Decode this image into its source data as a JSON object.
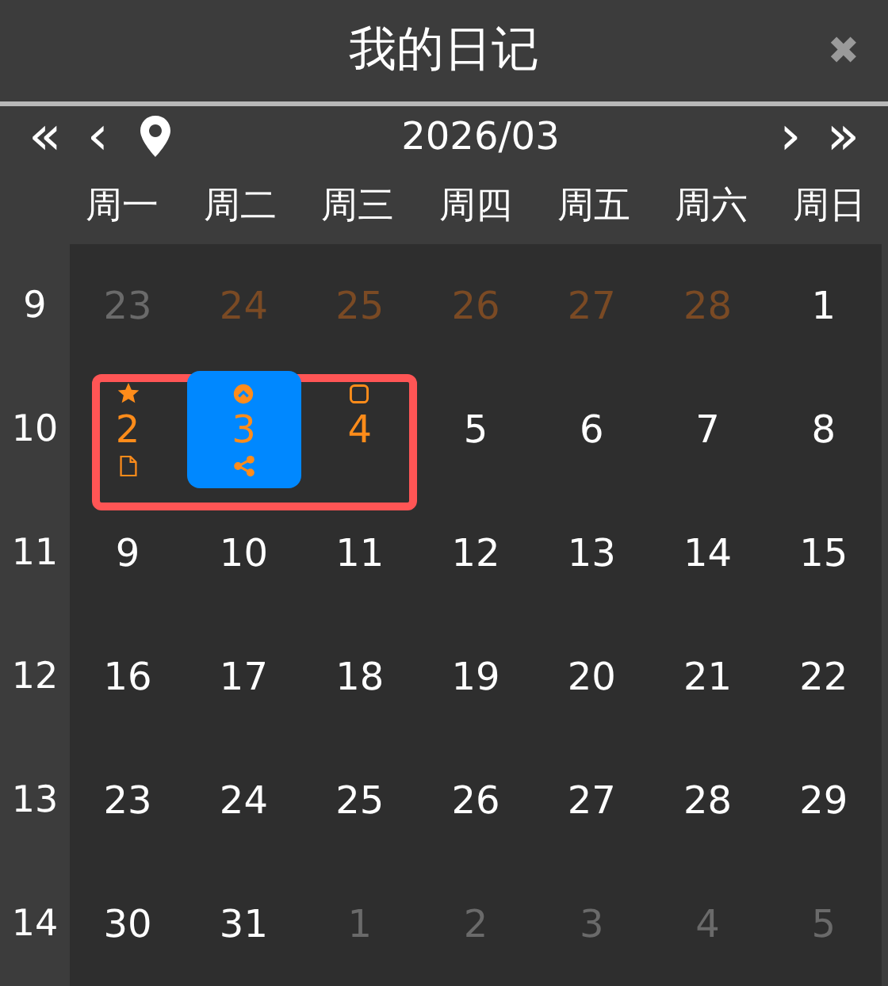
{
  "window": {
    "title": "我的日记",
    "close": "✖"
  },
  "nav": {
    "first": "«",
    "prev": "‹",
    "month": "2026/03",
    "next": "›",
    "last": "»"
  },
  "weekdays": [
    "周一",
    "周二",
    "周三",
    "周四",
    "周五",
    "周六",
    "周日"
  ],
  "weeks": [
    {
      "number": "9",
      "highlighted": false,
      "days": [
        {
          "day": "23",
          "kind": "other",
          "selected": false
        },
        {
          "day": "24",
          "kind": "other-marked",
          "selected": false
        },
        {
          "day": "25",
          "kind": "other-marked",
          "selected": false
        },
        {
          "day": "26",
          "kind": "other-marked",
          "selected": false
        },
        {
          "day": "27",
          "kind": "other-marked",
          "selected": false
        },
        {
          "day": "28",
          "kind": "other-marked",
          "selected": false
        },
        {
          "day": "1",
          "kind": "current",
          "selected": false
        }
      ]
    },
    {
      "number": "10",
      "highlighted": true,
      "days": [
        {
          "day": "2",
          "kind": "marked",
          "selected": false,
          "top_icons": [
            {
              "kind": "star"
            }
          ],
          "bottom_icons": [
            {
              "kind": "file"
            }
          ]
        },
        {
          "day": "3",
          "kind": "marked",
          "selected": true,
          "top_icons": [
            {
              "kind": "chevron"
            }
          ],
          "bottom_icons": [
            {
              "kind": "share"
            }
          ]
        },
        {
          "day": "4",
          "kind": "marked",
          "selected": false,
          "top_icons": [
            {
              "kind": "square"
            }
          ]
        },
        {
          "day": "5",
          "kind": "current",
          "selected": false
        },
        {
          "day": "6",
          "kind": "current",
          "selected": false
        },
        {
          "day": "7",
          "kind": "current",
          "selected": false
        },
        {
          "day": "8",
          "kind": "current",
          "selected": false
        }
      ]
    },
    {
      "number": "11",
      "highlighted": false,
      "days": [
        {
          "day": "9",
          "kind": "current",
          "selected": false
        },
        {
          "day": "10",
          "kind": "current",
          "selected": false
        },
        {
          "day": "11",
          "kind": "current",
          "selected": false
        },
        {
          "day": "12",
          "kind": "current",
          "selected": false
        },
        {
          "day": "13",
          "kind": "current",
          "selected": false
        },
        {
          "day": "14",
          "kind": "current",
          "selected": false
        },
        {
          "day": "15",
          "kind": "current",
          "selected": false
        }
      ]
    },
    {
      "number": "12",
      "highlighted": false,
      "days": [
        {
          "day": "16",
          "kind": "current",
          "selected": false
        },
        {
          "day": "17",
          "kind": "current",
          "selected": false
        },
        {
          "day": "18",
          "kind": "current",
          "selected": false
        },
        {
          "day": "19",
          "kind": "current",
          "selected": false
        },
        {
          "day": "20",
          "kind": "current",
          "selected": false
        },
        {
          "day": "21",
          "kind": "current",
          "selected": false
        },
        {
          "day": "22",
          "kind": "current",
          "selected": false
        }
      ]
    },
    {
      "number": "13",
      "highlighted": false,
      "days": [
        {
          "day": "23",
          "kind": "current",
          "selected": false
        },
        {
          "day": "24",
          "kind": "current",
          "selected": false
        },
        {
          "day": "25",
          "kind": "current",
          "selected": false
        },
        {
          "day": "26",
          "kind": "current",
          "selected": false
        },
        {
          "day": "27",
          "kind": "current",
          "selected": false
        },
        {
          "day": "28",
          "kind": "current",
          "selected": false
        },
        {
          "day": "29",
          "kind": "current",
          "selected": false
        }
      ]
    },
    {
      "number": "14",
      "highlighted": false,
      "days": [
        {
          "day": "30",
          "kind": "current",
          "selected": false
        },
        {
          "day": "31",
          "kind": "current",
          "selected": false
        },
        {
          "day": "1",
          "kind": "other",
          "selected": false
        },
        {
          "day": "2",
          "kind": "other",
          "selected": false
        },
        {
          "day": "3",
          "kind": "other",
          "selected": false
        },
        {
          "day": "4",
          "kind": "other",
          "selected": false
        },
        {
          "day": "5",
          "kind": "other",
          "selected": false
        }
      ]
    }
  ]
}
